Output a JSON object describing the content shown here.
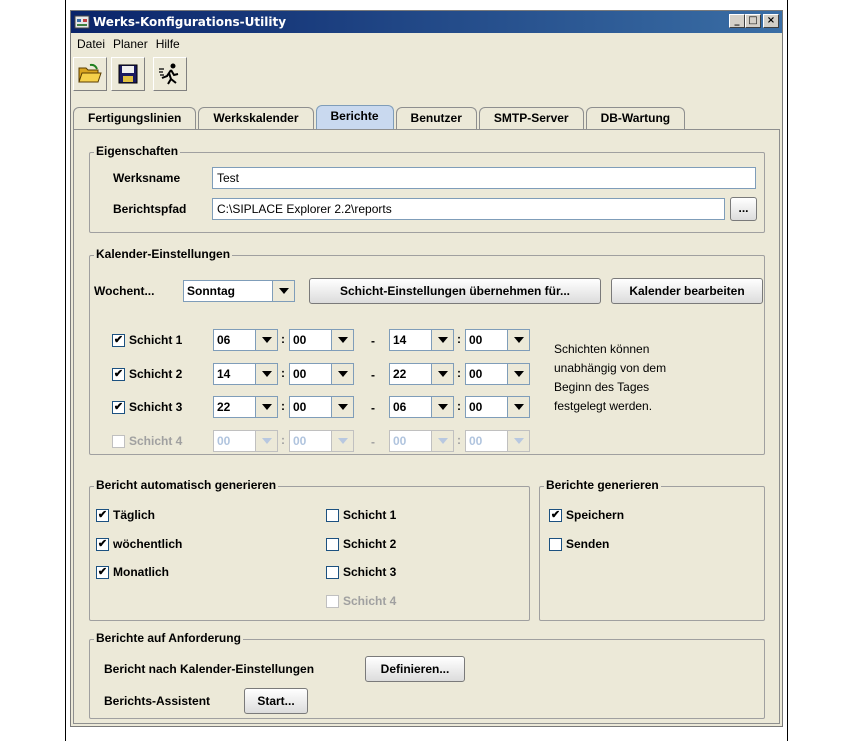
{
  "window": {
    "title": "Werks-Konfigurations-Utility",
    "buttons": [
      "_",
      "□",
      "×"
    ]
  },
  "menu": [
    "Datei",
    "Planer",
    "Hilfe"
  ],
  "toolbar": {
    "icons": [
      "open-folder-icon",
      "save-disk-icon",
      "run-icon"
    ]
  },
  "tabs": [
    {
      "label": "Fertigungslinien",
      "active": false
    },
    {
      "label": "Werkskalender",
      "active": false
    },
    {
      "label": "Berichte",
      "active": true
    },
    {
      "label": "Benutzer",
      "active": false
    },
    {
      "label": "SMTP-Server",
      "active": false
    },
    {
      "label": "DB-Wartung",
      "active": false
    }
  ],
  "properties": {
    "legend": "Eigenschaften",
    "plant_name_label": "Werksname",
    "plant_name_value": "Test",
    "report_path_label": "Berichtspfad",
    "report_path_value": "C:\\SIPLACE Explorer 2.2\\reports",
    "browse_label": "..."
  },
  "calendar": {
    "legend": "Kalender-Einstellungen",
    "weekday_label": "Wochent...",
    "weekday_value": "Sonntag",
    "apply_shift_label": "Schicht-Einstellungen übernehmen für...",
    "edit_calendar_label": "Kalender bearbeiten",
    "separator_colon": ":",
    "separator_dash": "-",
    "shifts": [
      {
        "label": "Schicht 1",
        "checked": true,
        "enabled": true,
        "from_h": "06",
        "from_m": "00",
        "to_h": "14",
        "to_m": "00"
      },
      {
        "label": "Schicht 2",
        "checked": true,
        "enabled": true,
        "from_h": "14",
        "from_m": "00",
        "to_h": "22",
        "to_m": "00"
      },
      {
        "label": "Schicht 3",
        "checked": true,
        "enabled": true,
        "from_h": "22",
        "from_m": "00",
        "to_h": "06",
        "to_m": "00"
      },
      {
        "label": "Schicht 4",
        "checked": false,
        "enabled": false,
        "from_h": "00",
        "from_m": "00",
        "to_h": "00",
        "to_m": "00"
      }
    ],
    "note_lines": [
      "Schichten können",
      "unabhängig von dem",
      "Beginn des Tages",
      "festgelegt werden."
    ]
  },
  "auto_generate": {
    "legend": "Bericht automatisch generieren",
    "periods": [
      {
        "label": "Täglich",
        "checked": true
      },
      {
        "label": "wöchentlich",
        "checked": true
      },
      {
        "label": "Monatlich",
        "checked": true
      }
    ],
    "shifts": [
      {
        "label": "Schicht 1",
        "checked": false,
        "enabled": true
      },
      {
        "label": "Schicht 2",
        "checked": false,
        "enabled": true
      },
      {
        "label": "Schicht 3",
        "checked": false,
        "enabled": true
      },
      {
        "label": "Schicht 4",
        "checked": false,
        "enabled": false
      }
    ]
  },
  "generate": {
    "legend": "Berichte generieren",
    "options": [
      {
        "label": "Speichern",
        "checked": true
      },
      {
        "label": "Senden",
        "checked": false
      }
    ]
  },
  "on_demand": {
    "legend": "Berichte auf Anforderung",
    "calendar_report_label": "Bericht nach Kalender-Einstellungen",
    "define_label": "Definieren...",
    "wizard_label": "Berichts-Assistent",
    "start_label": "Start..."
  }
}
